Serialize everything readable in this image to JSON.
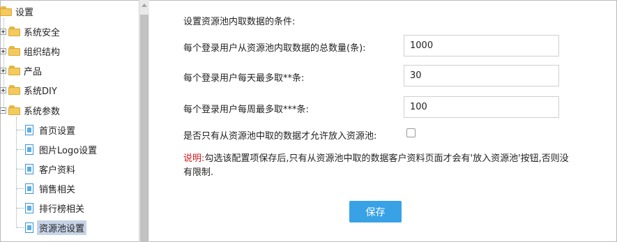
{
  "tree": {
    "root": "设置",
    "folders": [
      "系统安全",
      "组织结构",
      "产品",
      "系统DIY",
      "系统参数"
    ],
    "children": [
      "首页设置",
      "图片Logo设置",
      "客户资料",
      "销售相关",
      "排行榜相关",
      "资源池设置"
    ],
    "selected": "资源池设置"
  },
  "form": {
    "title": "设置资源池内取数据的条件:",
    "total_label": "每个登录用户从资源池内取数据的总数量(条):",
    "total_value": "1000",
    "daily_label": "每个登录用户每天最多取**条:",
    "daily_value": "30",
    "weekly_label": "每个登录用户每周最多取***条:",
    "weekly_value": "100",
    "only_label": "是否只有从资源池中取的数据才允许放入资源池:",
    "only_checked": false,
    "note_prefix": "说明:",
    "note_text": "勾选该配置项保存后,只有从资源池中取的数据客户资料页面才会有'放入资源池'按钮,否则没有限制.",
    "save_label": "保存"
  },
  "colors": {
    "accent": "#39a2e6",
    "note": "#d11a1a",
    "selected": "#c6d3e7"
  }
}
